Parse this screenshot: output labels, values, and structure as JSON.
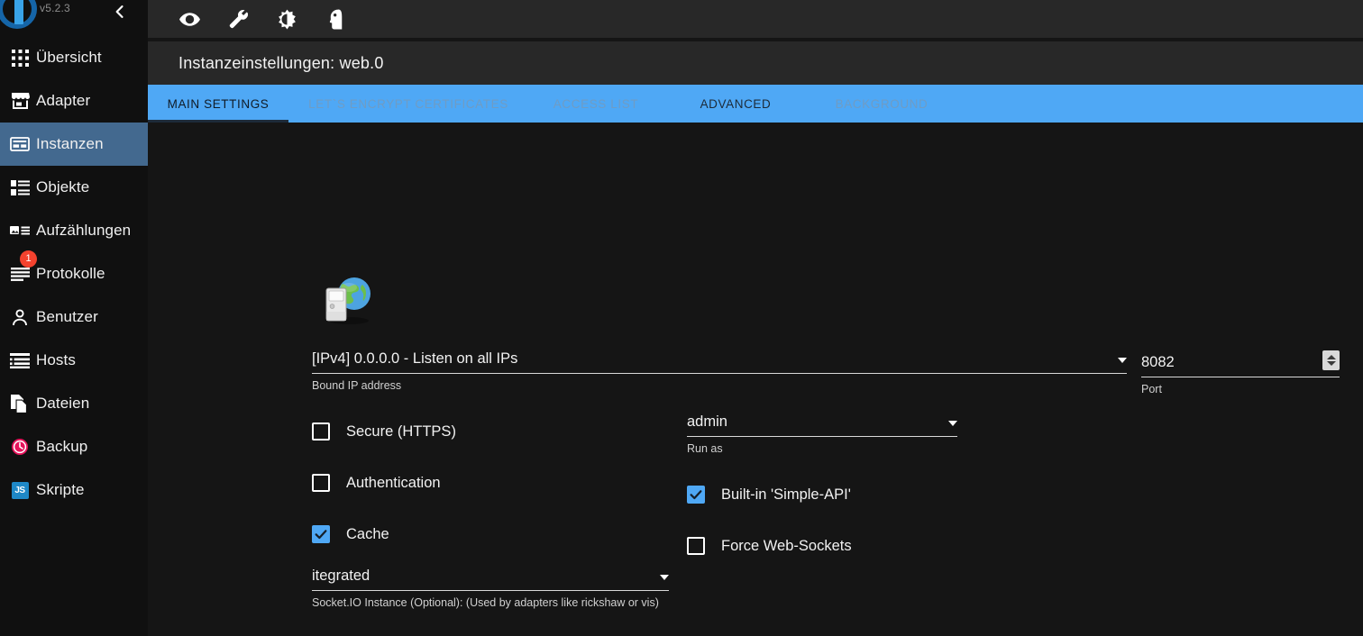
{
  "sidebar": {
    "logo_icon": "iobroker-logo-icon",
    "version": "v5.2.3",
    "collapse_icon": "chevron-left-icon",
    "items": [
      {
        "id": "uebersicht",
        "label": "Übersicht",
        "icon": "grid-apps-icon",
        "selected": false,
        "badge": null
      },
      {
        "id": "adapter",
        "label": "Adapter",
        "icon": "store-icon",
        "selected": false,
        "badge": null
      },
      {
        "id": "instanzen",
        "label": "Instanzen",
        "icon": "instances-icon",
        "selected": true,
        "badge": null
      },
      {
        "id": "objekte",
        "label": "Objekte",
        "icon": "list-objects-icon",
        "selected": false,
        "badge": null
      },
      {
        "id": "aufzaehlungen",
        "label": "Aufzählungen",
        "icon": "enumerations-icon",
        "selected": false,
        "badge": null
      },
      {
        "id": "protokolle",
        "label": "Protokolle",
        "icon": "logs-icon",
        "selected": false,
        "badge": "1"
      },
      {
        "id": "benutzer",
        "label": "Benutzer",
        "icon": "person-icon",
        "selected": false,
        "badge": null
      },
      {
        "id": "hosts",
        "label": "Hosts",
        "icon": "hosts-icon",
        "selected": false,
        "badge": null
      },
      {
        "id": "dateien",
        "label": "Dateien",
        "icon": "files-icon",
        "selected": false,
        "badge": null
      },
      {
        "id": "backup",
        "label": "Backup",
        "icon": "backup-clock-icon",
        "selected": false,
        "badge": null
      },
      {
        "id": "skripte",
        "label": "Skripte",
        "icon": "javascript-icon",
        "selected": false,
        "badge": null
      }
    ]
  },
  "toolbar": {
    "icons": [
      {
        "id": "expert-mode",
        "name": "eye-icon"
      },
      {
        "id": "commands",
        "name": "wrench-icon"
      },
      {
        "id": "theme-toggle",
        "name": "brightness-icon"
      },
      {
        "id": "user-menu",
        "name": "head-profile-icon"
      }
    ]
  },
  "header": {
    "title": "Instanzeinstellungen: web.0"
  },
  "tabs": [
    {
      "id": "main-settings",
      "label": "MAIN SETTINGS",
      "state": "active"
    },
    {
      "id": "lets-encrypt",
      "label": "LET`S ENCRYPT CERTIFICATES",
      "state": "normal"
    },
    {
      "id": "access-list",
      "label": "ACCESS LIST",
      "state": "normal"
    },
    {
      "id": "advanced",
      "label": "ADVANCED",
      "state": "hovered"
    },
    {
      "id": "background",
      "label": "BACKGROUND",
      "state": "normal"
    }
  ],
  "form": {
    "adapter_icon": "web-server-globe-icon",
    "bind_ip": {
      "value": "[IPv4] 0.0.0.0 - Listen on all IPs",
      "helper": "Bound IP address"
    },
    "port": {
      "value": "8082",
      "helper": "Port"
    },
    "run_as": {
      "value": "admin",
      "helper": "Run as"
    },
    "socket_io": {
      "value": "itegrated",
      "helper": "Socket.IO Instance (Optional): (Used by adapters like rickshaw or vis)"
    },
    "checkboxes_left": [
      {
        "id": "secure-https",
        "label": "Secure (HTTPS)",
        "checked": false
      },
      {
        "id": "authentication",
        "label": "Authentication",
        "checked": false
      },
      {
        "id": "cache",
        "label": "Cache",
        "checked": true
      }
    ],
    "checkboxes_right": [
      {
        "id": "simple-api",
        "label": "Built-in 'Simple-API'",
        "checked": true
      },
      {
        "id": "force-web-sockets",
        "label": "Force Web-Sockets",
        "checked": false
      }
    ]
  },
  "colors": {
    "accent_blue": "#4fa8f5",
    "selected_nav": "#43698f",
    "badge_red": "#f4422e",
    "panel_dark": "#282828",
    "background": "#151515"
  }
}
